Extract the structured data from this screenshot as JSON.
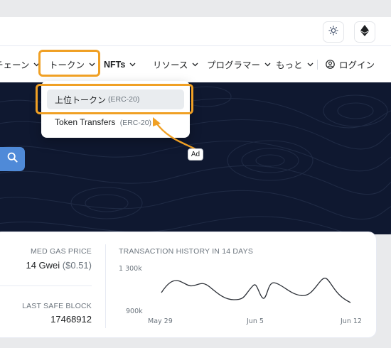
{
  "header": {
    "theme_icon": "sun-icon",
    "network_icon": "ethereum-icon"
  },
  "nav": {
    "items": [
      {
        "label": "チェーン",
        "icon": "chevron-down-icon"
      },
      {
        "label": "トークン",
        "icon": "chevron-down-icon"
      },
      {
        "label": "NFTs",
        "icon": "chevron-down-icon"
      },
      {
        "label": "リソース",
        "icon": "chevron-down-icon"
      },
      {
        "label": "プログラマー",
        "icon": "chevron-down-icon"
      },
      {
        "label": "もっと",
        "icon": "chevron-down-icon"
      }
    ],
    "login_label": "ログイン",
    "login_icon": "user-circle-icon"
  },
  "dropdown": {
    "items": [
      {
        "label": "上位トークン",
        "tag": "(ERC-20)"
      },
      {
        "label": "Token Transfers",
        "tag": "(ERC-20)"
      }
    ]
  },
  "annotation": {
    "badge": "Ad",
    "highlight_color": "#f0a024"
  },
  "search": {
    "icon": "search-icon"
  },
  "stats": {
    "gas_label": "MED GAS PRICE",
    "gas_value": "14 Gwei",
    "gas_usd": "($0.51)",
    "block_label": "LAST SAFE BLOCK",
    "block_value": "17468912"
  },
  "tx_chart": {
    "title": "TRANSACTION HISTORY IN 14 DAYS",
    "y_ticks": [
      "1 300k",
      "900k"
    ],
    "x_ticks": [
      "May 29",
      "Jun 5",
      "Jun 12"
    ]
  },
  "colors": {
    "accent": "#f0a024",
    "hero_bg": "#0f1830",
    "search_btn": "#4f8ad8"
  }
}
